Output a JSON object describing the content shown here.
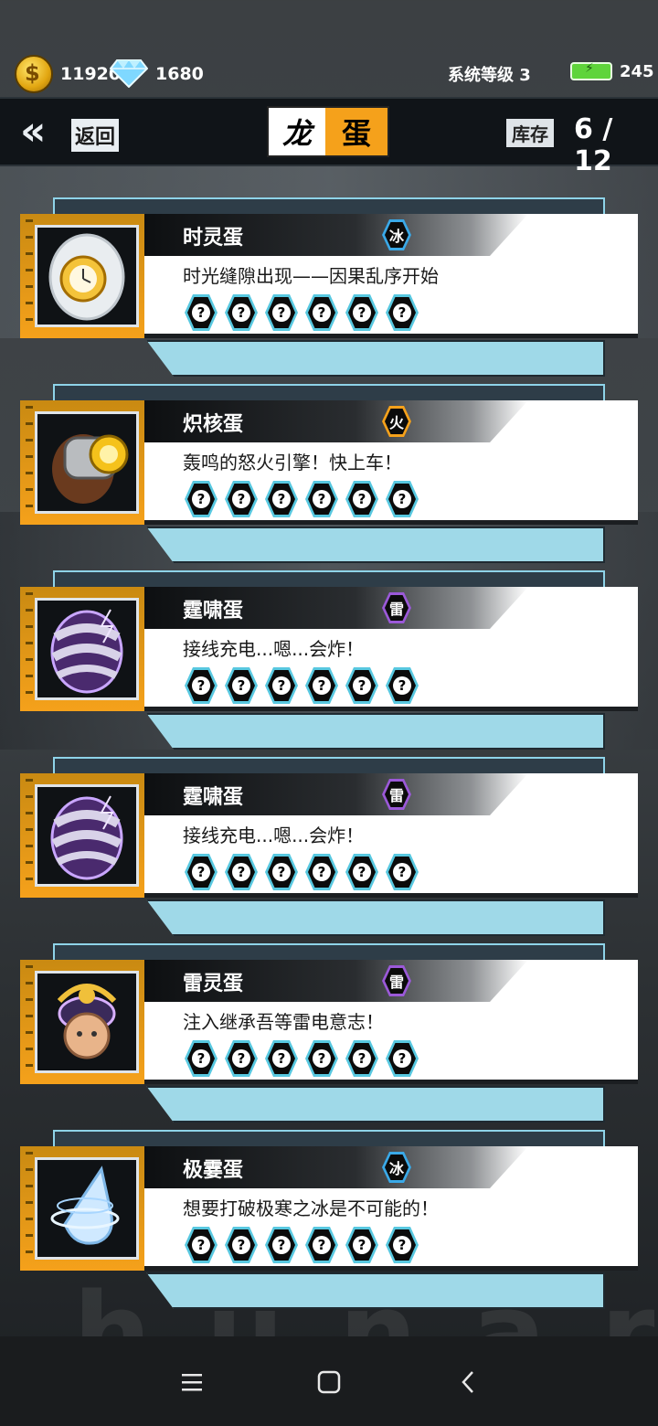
{
  "status": {
    "coins": "11920",
    "gems": "1680",
    "system_level": "系统等级 3",
    "energy": "245"
  },
  "header": {
    "back_label": "返回",
    "title_left": "龙",
    "title_right": "蛋",
    "stock_label": "库存",
    "stock_value": "6 / 12"
  },
  "cards": [
    {
      "name": "时灵蛋",
      "element": "冰",
      "element_color": "#3aa9e8",
      "description": "时光缝隙出现——因果乱序开始",
      "egg_icon": "clock-egg-icon",
      "slots": [
        "?",
        "?",
        "?",
        "?",
        "?",
        "?"
      ]
    },
    {
      "name": "炽核蛋",
      "element": "火",
      "element_color": "#f5a11b",
      "description": "轰鸣的怒火引擎！快上车！",
      "egg_icon": "engine-egg-icon",
      "slots": [
        "?",
        "?",
        "?",
        "?",
        "?",
        "?"
      ]
    },
    {
      "name": "霆啸蛋",
      "element": "雷",
      "element_color": "#9b59d8",
      "description": "接线充电...嗯...会炸！",
      "egg_icon": "thunder-egg-icon",
      "slots": [
        "?",
        "?",
        "?",
        "?",
        "?",
        "?"
      ]
    },
    {
      "name": "霆啸蛋",
      "element": "雷",
      "element_color": "#9b59d8",
      "description": "接线充电...嗯...会炸！",
      "egg_icon": "thunder-egg-icon",
      "slots": [
        "?",
        "?",
        "?",
        "?",
        "?",
        "?"
      ]
    },
    {
      "name": "雷灵蛋",
      "element": "雷",
      "element_color": "#9b59d8",
      "description": "注入继承吾等雷电意志！",
      "egg_icon": "samurai-egg-icon",
      "slots": [
        "?",
        "?",
        "?",
        "?",
        "?",
        "?"
      ]
    },
    {
      "name": "极霎蛋",
      "element": "冰",
      "element_color": "#3aa9e8",
      "description": "想要打破极寒之冰是不可能的！",
      "egg_icon": "ice-egg-icon",
      "slots": [
        "?",
        "?",
        "?",
        "?",
        "?",
        "?"
      ]
    }
  ],
  "background_text": "hunar"
}
